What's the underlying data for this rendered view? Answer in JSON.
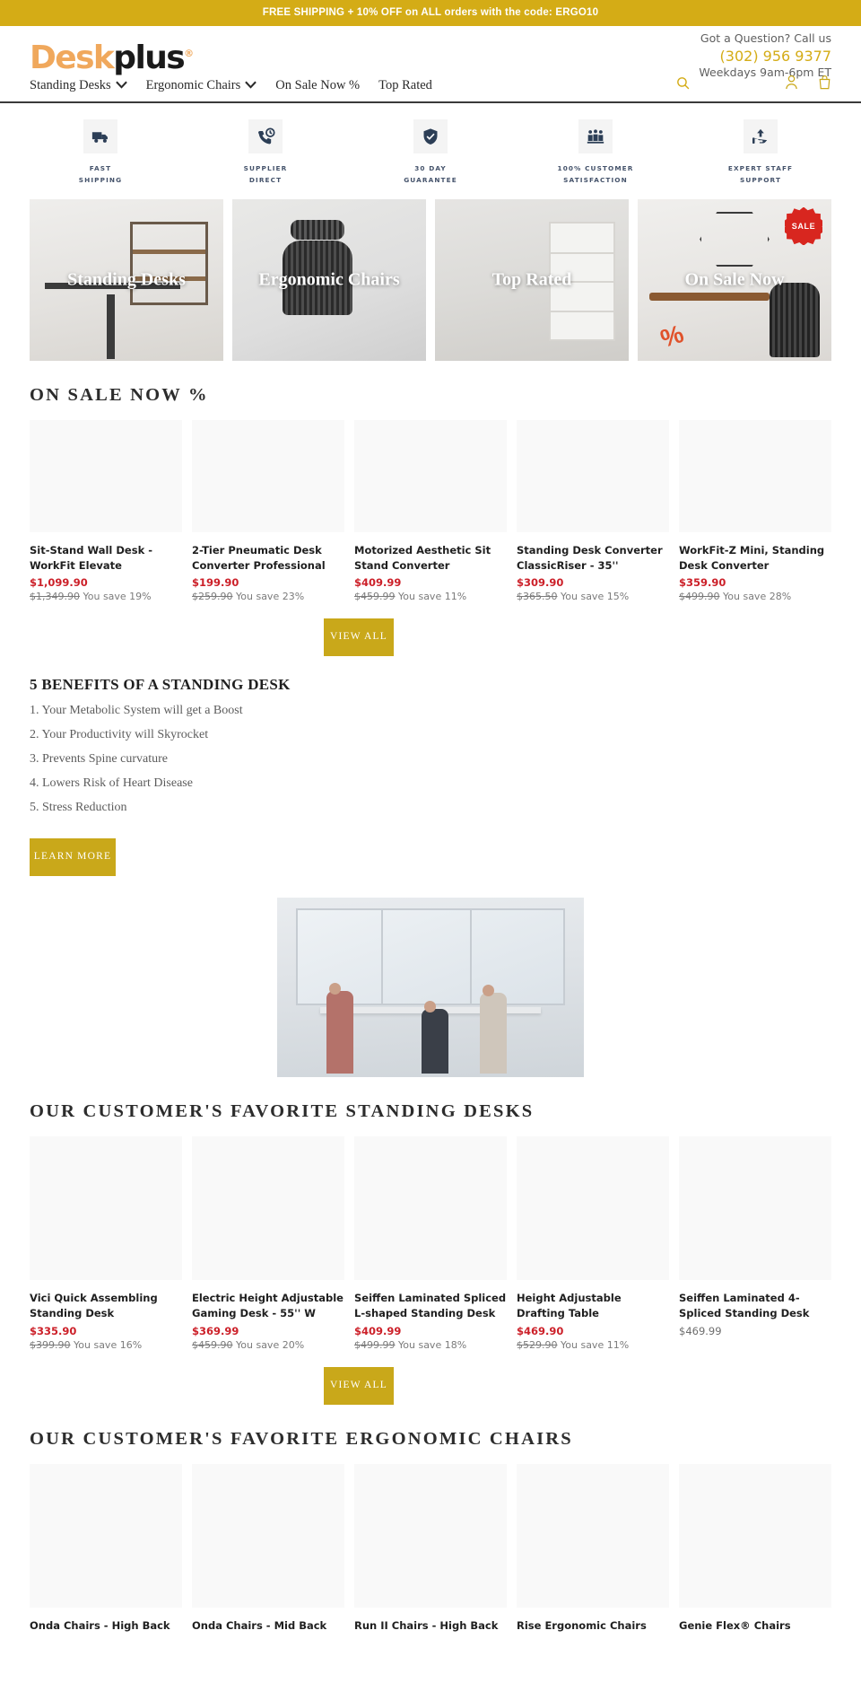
{
  "announcement": {
    "text": "FREE SHIPPING + 10% OFF on ALL orders with the code: ERGO10",
    "bg": "#d4ac16"
  },
  "header": {
    "logo": {
      "part1": "Desk",
      "part2": "plus",
      "registered": "®"
    },
    "contact": {
      "question": "Got a Question? Call us",
      "phone": "(302) 956 9377",
      "hours": "Weekdays 9am-6pm ET",
      "phone_color": "#d4ac16"
    },
    "search_icon": "search-icon",
    "account_icon": "user-icon",
    "cart_icon": "bag-icon",
    "nav": [
      {
        "label": "Standing Desks",
        "has_dropdown": true
      },
      {
        "label": "Ergonomic Chairs",
        "has_dropdown": true
      },
      {
        "label": "On Sale Now %",
        "has_dropdown": false
      },
      {
        "label": "Top Rated",
        "has_dropdown": false
      }
    ]
  },
  "trust_badges": [
    {
      "icon": "truck-icon",
      "line1": "FAST",
      "line2": "SHIPPING"
    },
    {
      "icon": "phone-clock-icon",
      "line1": "SUPPLIER",
      "line2": "DIRECT"
    },
    {
      "icon": "shield-check-icon",
      "line1": "30 DAY",
      "line2": "GUARANTEE"
    },
    {
      "icon": "people-icon",
      "line1": "100% CUSTOMER",
      "line2": "SATISFACTION"
    },
    {
      "icon": "support-hand-icon",
      "line1": "EXPERT STAFF",
      "line2": "SUPPORT"
    }
  ],
  "categories": [
    {
      "title": "Standing Desks",
      "badge": null
    },
    {
      "title": "Ergonomic Chairs",
      "badge": null
    },
    {
      "title": "Top Rated",
      "badge": null
    },
    {
      "title": "On Sale Now",
      "badge": "SALE"
    }
  ],
  "sale_section": {
    "title": "ON SALE NOW %",
    "view_all": "VIEW ALL",
    "products": [
      {
        "title": "Sit-Stand Wall Desk - WorkFit Elevate",
        "price": "$1,099.90",
        "compare": "$1,349.90",
        "save": "You save 19%",
        "on_sale": true
      },
      {
        "title": "2-Tier Pneumatic Desk Converter Professional",
        "price": "$199.90",
        "compare": "$259.90",
        "save": "You save 23%",
        "on_sale": true
      },
      {
        "title": "Motorized Aesthetic Sit Stand Converter",
        "price": "$409.99",
        "compare": "$459.99",
        "save": "You save 11%",
        "on_sale": true
      },
      {
        "title": "Standing Desk Converter ClassicRiser - 35''",
        "price": "$309.90",
        "compare": "$365.50",
        "save": "You save 15%",
        "on_sale": true
      },
      {
        "title": "WorkFit-Z Mini, Standing Desk Converter",
        "price": "$359.90",
        "compare": "$499.90",
        "save": "You save 28%",
        "on_sale": true
      }
    ]
  },
  "benefits": {
    "title": "5 BENEFITS OF A STANDING DESK",
    "items": [
      "1. Your Metabolic System will get a Boost",
      "2. Your Productivity will Skyrocket",
      "3. Prevents Spine curvature",
      "4. Lowers Risk of Heart Disease",
      "5. Stress Reduction"
    ],
    "learn_more": "LEARN MORE"
  },
  "hero_image": {
    "alt": "people collaborating at a standing desk in a bright office"
  },
  "desks_section": {
    "title": "OUR CUSTOMER'S FAVORITE STANDING DESKS",
    "view_all": "VIEW ALL",
    "products": [
      {
        "title": "Vici Quick Assembling Standing Desk",
        "price": "$335.90",
        "compare": "$399.90",
        "save": "You save 16%",
        "on_sale": true
      },
      {
        "title": "Electric Height Adjustable Gaming Desk - 55'' W",
        "price": "$369.99",
        "compare": "$459.90",
        "save": "You save 20%",
        "on_sale": true
      },
      {
        "title": "Seiffen Laminated Spliced L-shaped Standing Desk",
        "price": "$409.99",
        "compare": "$499.99",
        "save": "You save 18%",
        "on_sale": true
      },
      {
        "title": "Height Adjustable Drafting Table",
        "price": "$469.90",
        "compare": "$529.90",
        "save": "You save 11%",
        "on_sale": true
      },
      {
        "title": "Seiffen Laminated 4-Spliced Standing Desk",
        "price": "$469.99",
        "compare": "",
        "save": "",
        "on_sale": false
      }
    ]
  },
  "chairs_section": {
    "title": "OUR CUSTOMER'S FAVORITE ERGONOMIC CHAIRS",
    "products": [
      {
        "title": "Onda Chairs - High Back"
      },
      {
        "title": "Onda Chairs - Mid Back"
      },
      {
        "title": "Run II Chairs - High Back"
      },
      {
        "title": "Rise Ergonomic Chairs"
      },
      {
        "title": "Genie Flex® Chairs"
      }
    ]
  }
}
